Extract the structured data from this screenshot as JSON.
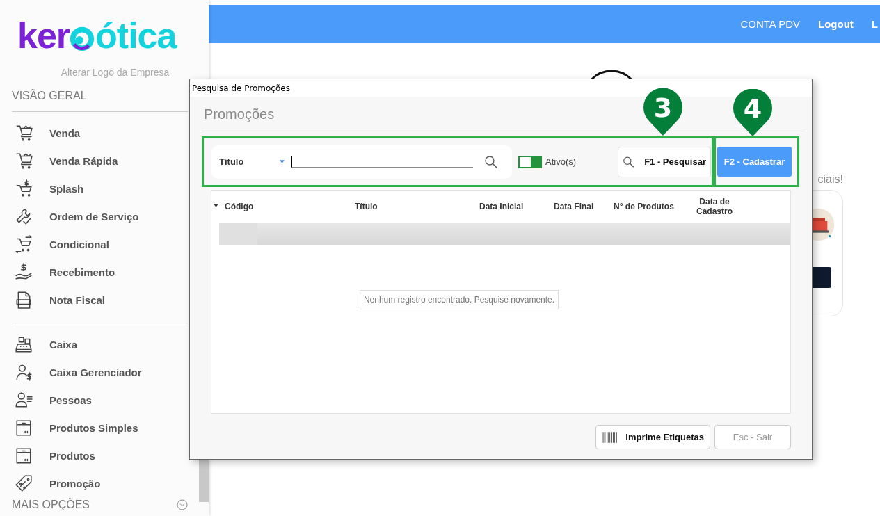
{
  "sidebar": {
    "logo": {
      "part_1": "ker",
      "part_2": "ótica"
    },
    "change_logo_link": "Alterar Logo da Empresa",
    "section_title": "VISÃO GERAL",
    "groups": [
      [
        {
          "label": "Venda"
        },
        {
          "label": "Venda Rápida"
        },
        {
          "label": "Splash"
        },
        {
          "label": "Ordem de Serviço"
        },
        {
          "label": "Condicional"
        },
        {
          "label": "Recebimento"
        },
        {
          "label": "Nota Fiscal"
        }
      ],
      [
        {
          "label": "Caixa"
        },
        {
          "label": "Caixa Gerenciador"
        },
        {
          "label": "Pessoas"
        },
        {
          "label": "Produtos Simples"
        },
        {
          "label": "Produtos"
        },
        {
          "label": "Promoção"
        }
      ]
    ],
    "more_options": {
      "label": "MAIS OPÇÕES",
      "expanded": false
    }
  },
  "top_bar": {
    "links": [
      "CONTA PDV",
      "Logout",
      "L"
    ]
  },
  "background": {
    "partial_text": "ciais!"
  },
  "dialog": {
    "title": "Pesquisa de Promoções",
    "heading": "Promoções",
    "search": {
      "field_selector": "Título",
      "active_toggle": {
        "label": "Ativo(s)",
        "on": true
      }
    },
    "search_button": "F1 - Pesquisar",
    "create_button": "F2 - Cadastrar",
    "table": {
      "columns": [
        {
          "label": "Código",
          "sorted": true
        },
        {
          "label": "Título",
          "sorted": false
        },
        {
          "label": "Data Inicial",
          "sorted": false
        },
        {
          "label": "Data Final",
          "sorted": false
        },
        {
          "label": "N° de Produtos",
          "sorted": false
        },
        {
          "label": "Data de Cadastro",
          "sorted": false
        }
      ],
      "empty_message": "Nenhum registro encontrado. Pesquise novamente."
    },
    "print_labels_button": "Imprime Etiquetas",
    "exit_button": {
      "label": "Esc - Sair",
      "disabled": true
    }
  },
  "annotations": [
    {
      "number": "3"
    },
    {
      "number": "4"
    }
  ]
}
